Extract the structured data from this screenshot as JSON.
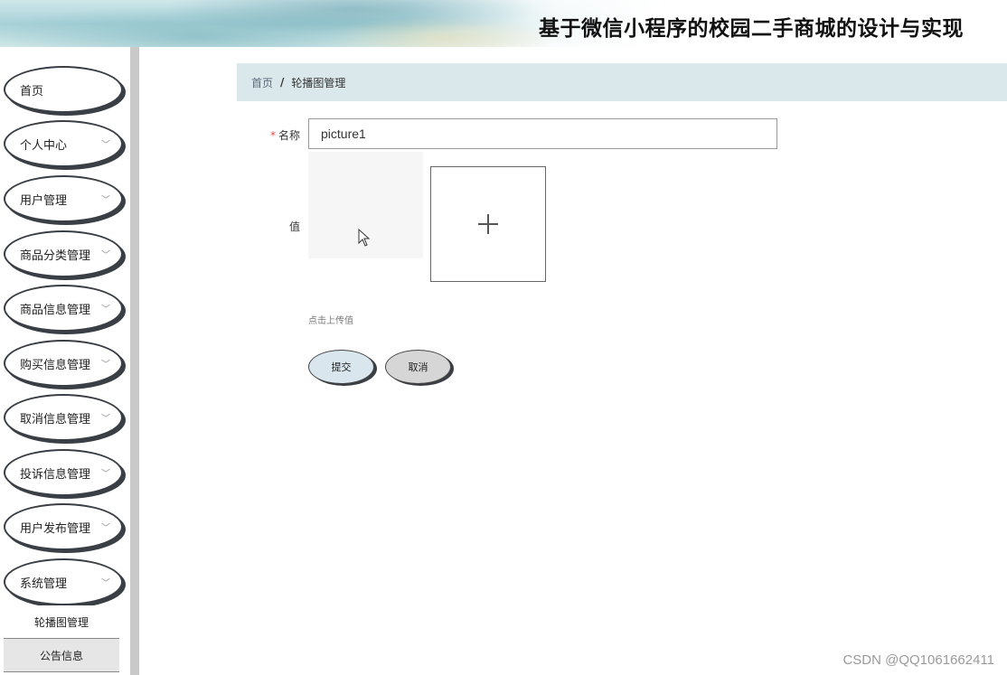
{
  "header": {
    "title": "基于微信小程序的校园二手商城的设计与实现"
  },
  "sidebar": {
    "items": [
      {
        "label": "首页",
        "has_chevron": false
      },
      {
        "label": "个人中心",
        "has_chevron": true
      },
      {
        "label": "用户管理",
        "has_chevron": true
      },
      {
        "label": "商品分类管理",
        "has_chevron": true
      },
      {
        "label": "商品信息管理",
        "has_chevron": true
      },
      {
        "label": "购买信息管理",
        "has_chevron": true
      },
      {
        "label": "取消信息管理",
        "has_chevron": true
      },
      {
        "label": "投诉信息管理",
        "has_chevron": true
      },
      {
        "label": "用户发布管理",
        "has_chevron": true
      },
      {
        "label": "系统管理",
        "has_chevron": true
      }
    ],
    "sub_items": [
      {
        "label": "轮播图管理",
        "active": true
      },
      {
        "label": "公告信息",
        "active": false
      }
    ]
  },
  "breadcrumb": {
    "home": "首页",
    "separator": "/",
    "current": "轮播图管理"
  },
  "form": {
    "name_label": "名称",
    "required_mark": "*",
    "name_value": "picture1",
    "value_label": "值",
    "upload_hint": "点击上传值",
    "submit_label": "提交",
    "cancel_label": "取消"
  },
  "watermark": "CSDN @QQ1061662411",
  "colors": {
    "breadcrumb_bg": "#dae8ec",
    "submit_bg": "#d9e6ee",
    "cancel_bg": "#d6d6d6",
    "required": "#e64c4c"
  }
}
